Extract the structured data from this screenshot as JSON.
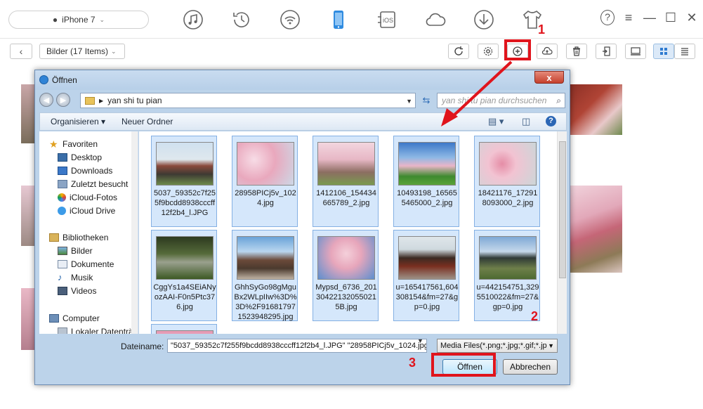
{
  "topbar": {
    "device": "iPhone 7",
    "icons": [
      "music-icon",
      "history-icon",
      "wifi-sync-icon",
      "phone-icon",
      "ios-icon",
      "cloud-icon",
      "download-icon",
      "tshirt-icon"
    ],
    "ios_label": "iOS",
    "help": "?",
    "menu": "≡",
    "minimize": "—",
    "maximize": "☐",
    "close": "✕"
  },
  "toolbar": {
    "back": "‹",
    "album": "Bilder (17 Items)"
  },
  "annotations": {
    "step1": "1",
    "step2": "2",
    "step3": "3",
    "accent": "#e0141c"
  },
  "dialog": {
    "title": "Öffnen",
    "close": "x",
    "path": "yan shi tu pian",
    "search_placeholder": "yan shi tu pian durchsuchen",
    "cmd_organize": "Organisieren ▾",
    "cmd_new_folder": "Neuer Ordner",
    "nav": {
      "favorites": "Favoriten",
      "desktop": "Desktop",
      "downloads": "Downloads",
      "recent": "Zuletzt besucht",
      "icloud_photos": "iCloud-Fotos",
      "icloud_drive": "iCloud Drive",
      "libraries": "Bibliotheken",
      "pictures": "Bilder",
      "documents": "Dokumente",
      "music": "Musik",
      "videos": "Videos",
      "computer": "Computer",
      "local_disk": "Lokaler Datenträger"
    },
    "files": [
      {
        "name": "5037_59352c7f255f9bcdd8938cccff12f2b4_l.JPG",
        "selected": true
      },
      {
        "name": "28958PICj5v_1024.jpg",
        "selected": true
      },
      {
        "name": "1412106_154434665789_2.jpg",
        "selected": true
      },
      {
        "name": "10493198_165655465000_2.jpg",
        "selected": true
      },
      {
        "name": "18421176_172918093000_2.jpg",
        "selected": true
      },
      {
        "name": "CggYs1a4SEiANyozAAI-F0n5Ptc376.jpg",
        "selected": true
      },
      {
        "name": "GhhSyGo98gMguBx2WLpIIw%3D%3D%2F91681797 1523948295.jpg",
        "selected": true
      },
      {
        "name": "Mypsd_6736_201304221320550215B.jpg",
        "selected": true
      },
      {
        "name": "u=165417561,604308154&fm=27&gp=0.jpg",
        "selected": true
      },
      {
        "name": "u=442154751,3295510022&fm=27&gp=0.jpg",
        "selected": true
      },
      {
        "name": "",
        "selected": true
      }
    ],
    "filename_label": "Dateiname:",
    "filename_value": "\"5037_59352c7f255f9bcdd8938cccff12f2b4_l.JPG\" \"28958PICj5v_1024.jpg\" \"",
    "filetype": "Media Files(*.png;*.jpg;*.gif;*.jp",
    "open": "Öffnen",
    "cancel": "Abbrechen"
  }
}
